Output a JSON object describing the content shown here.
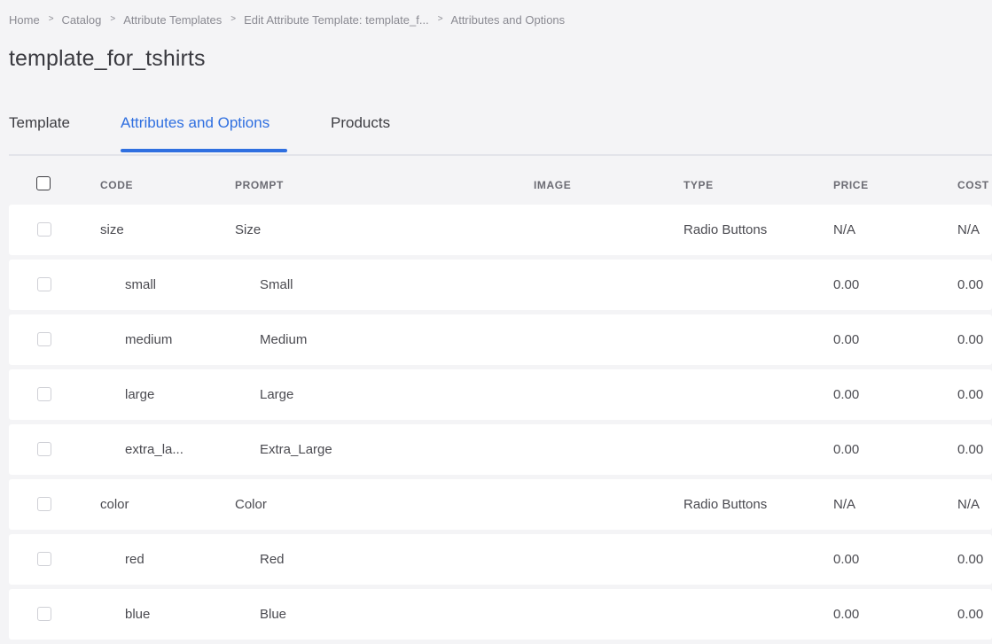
{
  "breadcrumb": [
    "Home",
    "Catalog",
    "Attribute Templates",
    "Edit Attribute Template: template_f...",
    "Attributes and Options"
  ],
  "breadcrumb_separator": ">",
  "page_title": "template_for_tshirts",
  "tabs": [
    {
      "label": "Template",
      "active": false
    },
    {
      "label": "Attributes and Options",
      "active": true
    },
    {
      "label": "Products",
      "active": false
    }
  ],
  "accent_color": "#2f6fe0",
  "table": {
    "headers": {
      "code": "CODE",
      "prompt": "PROMPT",
      "image": "IMAGE",
      "type": "TYPE",
      "price": "PRICE",
      "cost": "COST"
    },
    "rows": [
      {
        "code": "size",
        "prompt": "Size",
        "type": "Radio Buttons",
        "price": "N/A",
        "cost": "N/A",
        "level": 0
      },
      {
        "code": "small",
        "prompt": "Small",
        "type": "",
        "price": "0.00",
        "cost": "0.00",
        "level": 1
      },
      {
        "code": "medium",
        "prompt": "Medium",
        "type": "",
        "price": "0.00",
        "cost": "0.00",
        "level": 1
      },
      {
        "code": "large",
        "prompt": "Large",
        "type": "",
        "price": "0.00",
        "cost": "0.00",
        "level": 1
      },
      {
        "code": "extra_la...",
        "prompt": "Extra_Large",
        "type": "",
        "price": "0.00",
        "cost": "0.00",
        "level": 1
      },
      {
        "code": "color",
        "prompt": "Color",
        "type": "Radio Buttons",
        "price": "N/A",
        "cost": "N/A",
        "level": 0
      },
      {
        "code": "red",
        "prompt": "Red",
        "type": "",
        "price": "0.00",
        "cost": "0.00",
        "level": 1
      },
      {
        "code": "blue",
        "prompt": "Blue",
        "type": "",
        "price": "0.00",
        "cost": "0.00",
        "level": 1
      }
    ]
  }
}
